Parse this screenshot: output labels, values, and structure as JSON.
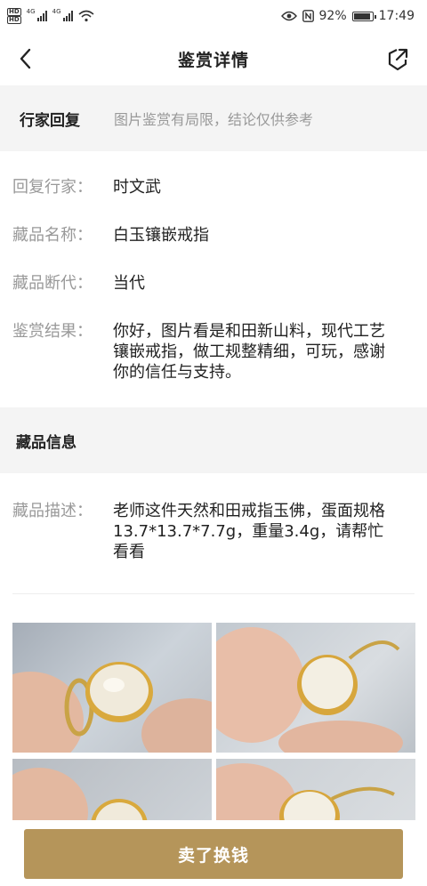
{
  "status_bar": {
    "hd_top": "HD",
    "hd_bottom": "HD",
    "net1": "4G",
    "net2": "4G",
    "battery": "92%",
    "time": "17:49"
  },
  "header": {
    "title": "鉴赏详情"
  },
  "reply_section": {
    "heading": "行家回复",
    "disclaimer": "图片鉴赏有局限，结论仅供参考"
  },
  "details": [
    {
      "label": "回复行家：",
      "value": "时文武"
    },
    {
      "label": "藏品名称：",
      "value": "白玉镶嵌戒指"
    },
    {
      "label": "藏品断代：",
      "value": "当代"
    },
    {
      "label": "鉴赏结果：",
      "value": "你好，图片看是和田新山料，现代工艺镶嵌戒指，做工规整精细，可玩，感谢你的信任与支持。"
    }
  ],
  "info_section": {
    "heading": "藏品信息",
    "desc_label": "藏品描述：",
    "desc_value": "老师这件天然和田戒指玉佛，蛋面规格13.7*13.7*7.7g，重量3.4g，请帮忙看看"
  },
  "actions": {
    "sell_label": "卖了换钱"
  },
  "colors": {
    "accent": "#b5955a",
    "band_bg": "#f4f4f4",
    "label_gray": "#999999"
  },
  "icons": [
    "back-chevron-icon",
    "share-icon",
    "eye-icon",
    "nfc-icon",
    "wifi-icon",
    "battery-icon"
  ]
}
